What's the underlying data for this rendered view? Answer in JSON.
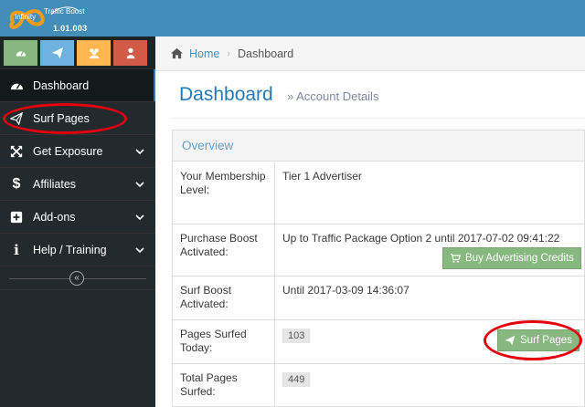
{
  "logo": {
    "word1": "Infinity",
    "word2": "Traffic Boost",
    "version": "1.01.003"
  },
  "shortcuts": [
    {
      "name": "dashboard-shortcut",
      "color": "#87b87f",
      "icon": "tachometer-icon"
    },
    {
      "name": "surf-shortcut",
      "color": "#6fb3e0",
      "icon": "paper-plane-icon"
    },
    {
      "name": "users-shortcut",
      "color": "#ffb752",
      "icon": "users-icon"
    },
    {
      "name": "profile-shortcut",
      "color": "#d15b47",
      "icon": "user-icon"
    }
  ],
  "sidebar": {
    "items": [
      {
        "label": "Dashboard",
        "icon": "tachometer-icon"
      },
      {
        "label": "Surf Pages",
        "icon": "paper-plane-icon"
      },
      {
        "label": "Get Exposure",
        "icon": "arrows-icon"
      },
      {
        "label": "Affiliates",
        "icon": "dollar-icon"
      },
      {
        "label": "Add-ons",
        "icon": "plus-square-icon"
      },
      {
        "label": "Help / Training",
        "icon": "info-icon"
      }
    ],
    "collapse_glyph": "«"
  },
  "breadcrumb": {
    "home": "Home",
    "current": "Dashboard"
  },
  "page": {
    "title": "Dashboard",
    "subtitle": "» Account Details"
  },
  "overview": {
    "heading": "Overview",
    "rows": [
      {
        "label": "Your Membership Level:",
        "value": "Tier 1 Advertiser"
      },
      {
        "label": "Purchase Boost Activated:",
        "value": "Up to Traffic Package Option 2 until 2017-07-02 09:41:22"
      },
      {
        "label": "Surf Boost Activated:",
        "value": "Until 2017-03-09 14:36:07"
      },
      {
        "label": "Pages Surfed Today:",
        "value": "103"
      },
      {
        "label": "Total Pages Surfed:",
        "value": "449"
      }
    ],
    "buy_button": "Buy Advertising Credits",
    "surf_button": "Surf Pages"
  },
  "colors": {
    "navbar": "#438eb9",
    "sidebar": "#222a2d",
    "accent": "#2679b5",
    "button_green": "#87b87f",
    "annotation_red": "#e4000f"
  }
}
